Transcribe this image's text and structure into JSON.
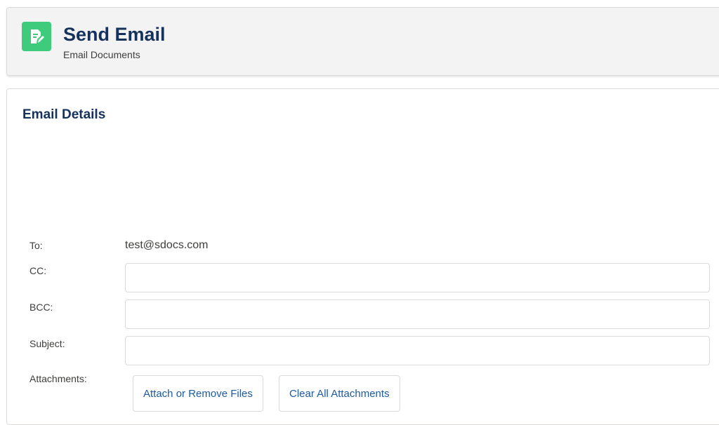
{
  "header": {
    "title": "Send Email",
    "subtitle": "Email Documents",
    "icon": "document-edit-icon",
    "icon_color": "#3ecb7b"
  },
  "section": {
    "title": "Email Details"
  },
  "form": {
    "to": {
      "label": "To:",
      "value": "test@sdocs.com"
    },
    "cc": {
      "label": "CC:",
      "value": "",
      "placeholder": ""
    },
    "bcc": {
      "label": "BCC:",
      "value": "",
      "placeholder": ""
    },
    "subject": {
      "label": "Subject:",
      "value": "",
      "placeholder": ""
    },
    "attachments": {
      "label": "Attachments:",
      "attach_button": "Attach or Remove Files",
      "clear_button": "Clear All Attachments"
    }
  },
  "colors": {
    "title_text": "#16325c",
    "link_button_text": "#1c5aa1",
    "border": "#dddbda",
    "header_bg": "#f3f3f3"
  }
}
